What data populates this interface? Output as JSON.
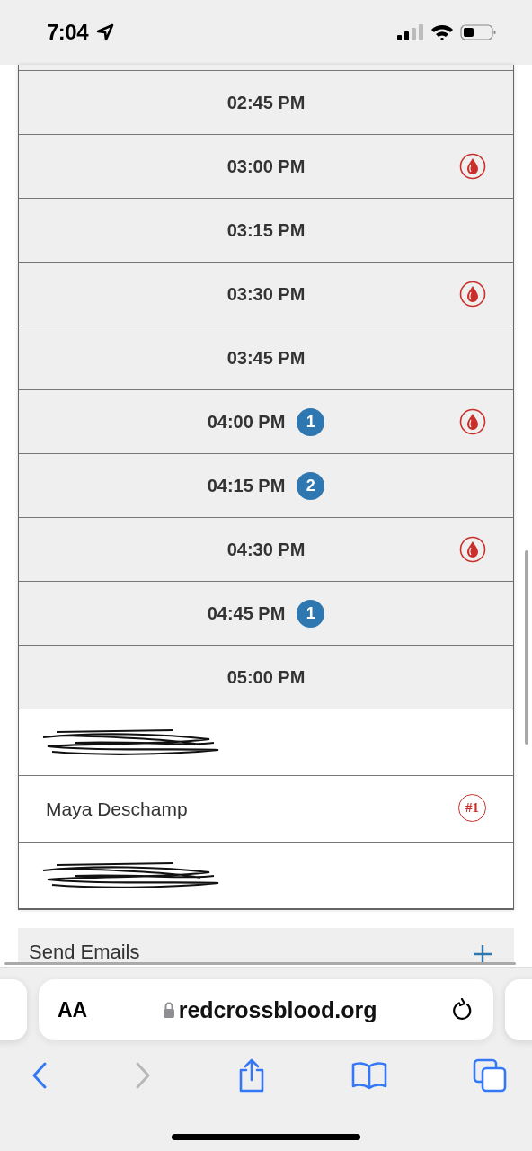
{
  "status_bar": {
    "time": "7:04",
    "location": true
  },
  "slots": [
    {
      "time": "02:45 PM",
      "donation": false
    },
    {
      "time": "03:00 PM",
      "donation": true
    },
    {
      "time": "03:15 PM",
      "donation": false
    },
    {
      "time": "03:30 PM",
      "donation": true
    },
    {
      "time": "03:45 PM",
      "donation": false
    },
    {
      "time": "04:00 PM",
      "count": "1",
      "donation": true
    },
    {
      "time": "04:15 PM",
      "count": "2",
      "donation": false
    },
    {
      "time": "04:30 PM",
      "donation": true
    },
    {
      "time": "04:45 PM",
      "count": "1",
      "donation": false
    },
    {
      "time": "05:00 PM",
      "donation": false
    }
  ],
  "people": [
    {
      "kind": "redacted"
    },
    {
      "kind": "name",
      "name": "Maya Deschamp",
      "badge": "#1"
    },
    {
      "kind": "redacted"
    }
  ],
  "send_emails": {
    "label": "Send Emails"
  },
  "browser": {
    "text_size": "AA",
    "url": "redcrossblood.org",
    "forward_enabled": false
  }
}
